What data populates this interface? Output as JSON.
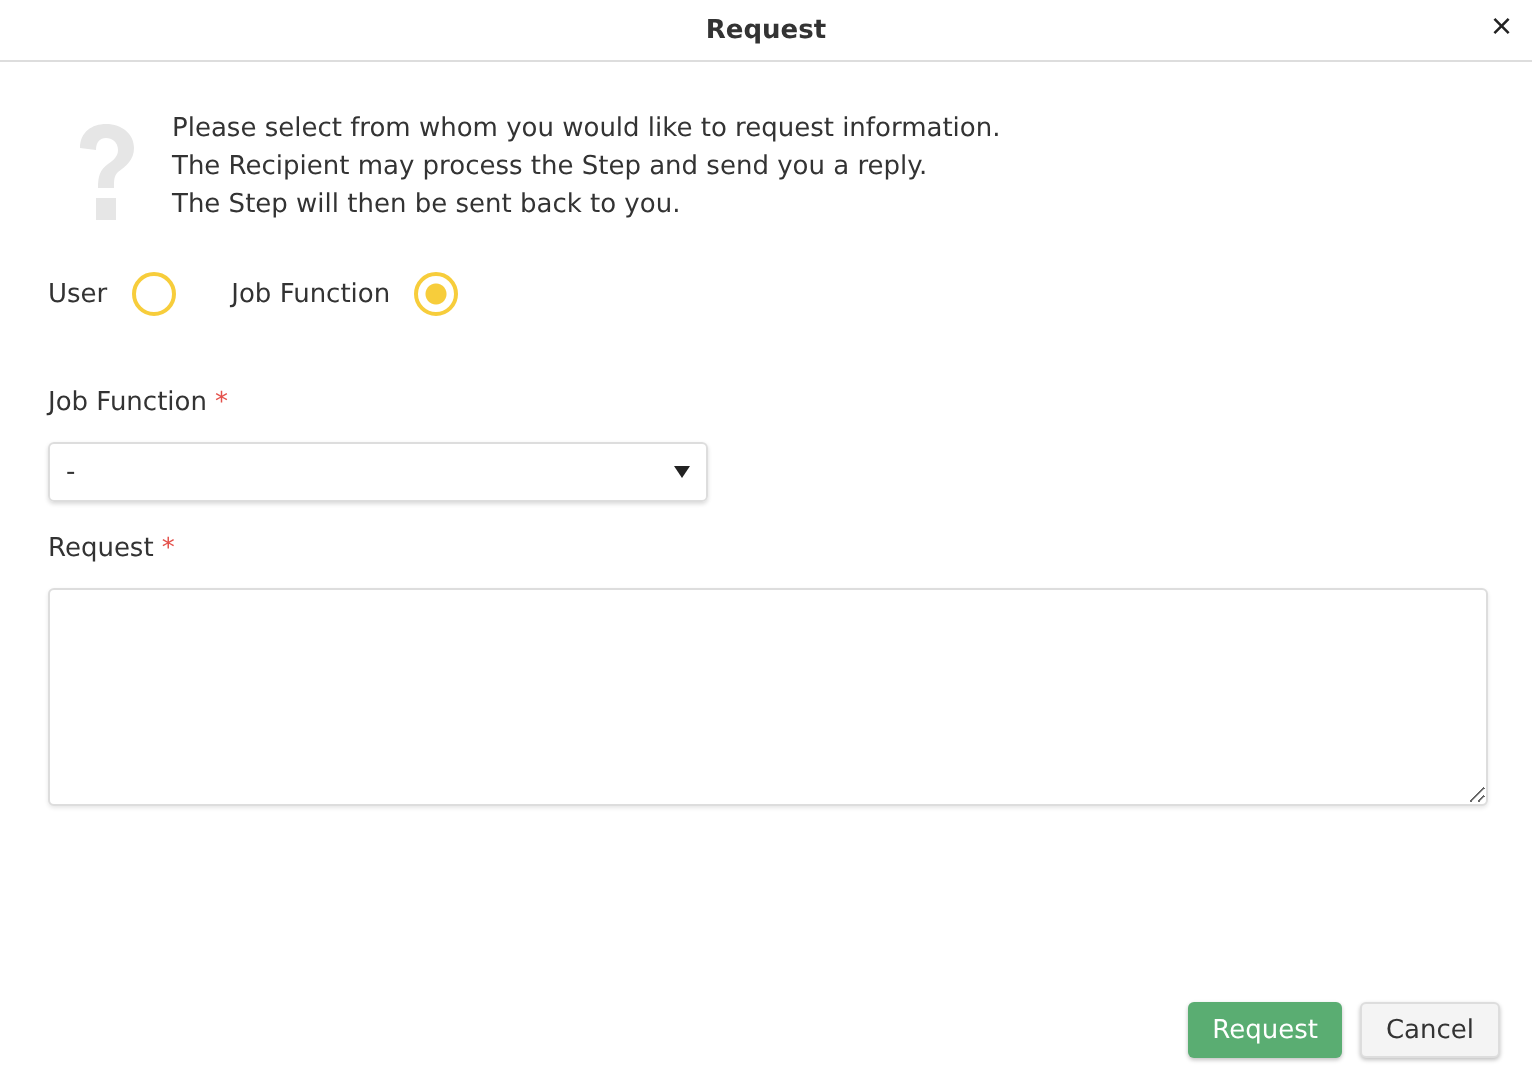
{
  "window": {
    "title": "Request",
    "close": "×"
  },
  "info": {
    "lines": [
      "Please select from whom you would like to request information.",
      "The Recipient may process the Step and send you a reply.",
      "The Step will then be sent back to you."
    ]
  },
  "recipient_options": [
    {
      "label": "User",
      "selected": false
    },
    {
      "label": "Job Function",
      "selected": true
    }
  ],
  "job_function": {
    "label": "Job Function",
    "required_mark": "*",
    "value": "-"
  },
  "request": {
    "label": "Request",
    "required_mark": "*"
  },
  "buttons": [
    {
      "label": "Request",
      "kind": "primary"
    },
    {
      "label": "Cancel",
      "kind": "secondary"
    }
  ]
}
